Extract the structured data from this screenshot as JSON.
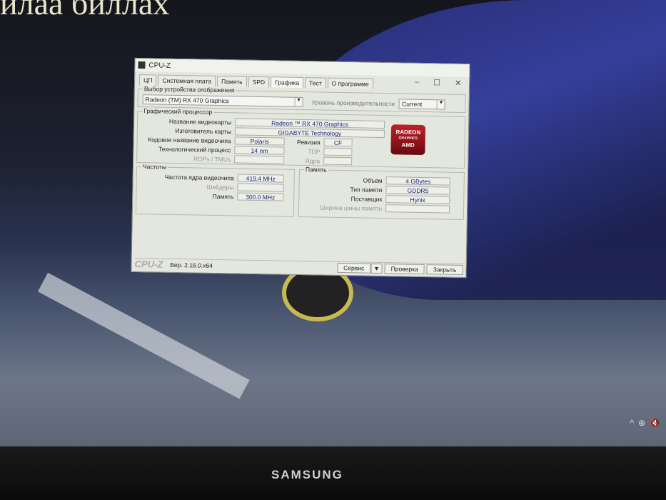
{
  "wallpaper": {
    "text": "илаа биллах"
  },
  "monitor": {
    "brand": "SAMSUNG"
  },
  "window": {
    "title": "CPU-Z",
    "tabs": [
      "ЦП",
      "Системная плата",
      "Память",
      "SPD",
      "Графика",
      "Тест",
      "О программе"
    ],
    "device_select": {
      "legend": "Выбор устройства отображения",
      "value": "Radeon (TM) RX 470 Graphics",
      "perf_label": "Уровень производительности",
      "perf_value": "Current"
    },
    "gpu": {
      "legend": "Графический процессор",
      "name_label": "Название видеокарты",
      "name": "Radeon ™ RX 470 Graphics",
      "vendor_label": "Изготовитель карты",
      "vendor": "GIGABYTE Technology",
      "codename_label": "Кодовое название видеочипа",
      "codename": "Polaris",
      "revision_label": "Ревизия",
      "revision": "CF",
      "process_label": "Технологический процесс",
      "process": "14 nm",
      "tdp_label": "TDP",
      "rops_label": "ROPs / TMUs",
      "cores_label": "Ядра",
      "logo_main": "RADEON",
      "logo_sub": "GRAPHICS",
      "logo_brand": "AMD"
    },
    "clocks": {
      "legend": "Частоты",
      "core_label": "Частота ядра видеочипа",
      "core": "419.4 MHz",
      "shader_label": "Шейдеры",
      "memory_label": "Память",
      "memory": "300.0 MHz"
    },
    "memory": {
      "legend": "Память",
      "size_label": "Объём",
      "size": "4 GBytes",
      "type_label": "Тип памяти",
      "type": "GDDR5",
      "vendor_label": "Поставщик",
      "vendor": "Hynix",
      "bus_label": "Ширина шины памяти"
    },
    "footer": {
      "brand": "CPU-Z",
      "version": "Вер. 2.16.0.x64",
      "service": "Сервис",
      "validate": "Проверка",
      "close": "Закрыть"
    }
  }
}
